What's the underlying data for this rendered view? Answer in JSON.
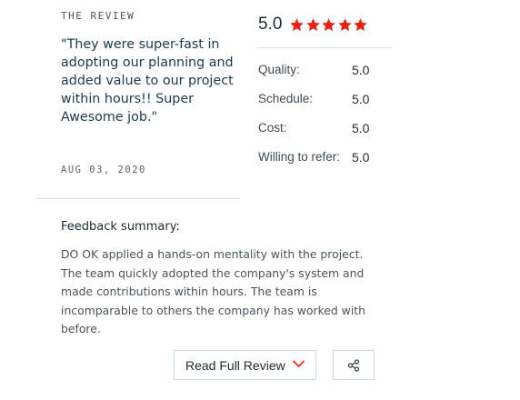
{
  "review": {
    "section_label": "THE REVIEW",
    "quote": "\"They were super-fast in adopting our planning and added value to our project within hours!! Super Awesome job.\"",
    "date": "AUG 03, 2020"
  },
  "rating": {
    "overall": "5.0",
    "stars": 5,
    "star_color": "#e62415",
    "items": [
      {
        "label": "Quality:",
        "value": "5.0"
      },
      {
        "label": "Schedule:",
        "value": "5.0"
      },
      {
        "label": "Cost:",
        "value": "5.0"
      },
      {
        "label": "Willing to refer:",
        "value": "5.0"
      }
    ]
  },
  "summary": {
    "title": "Feedback summary:",
    "text": "DO OK applied a hands-on mentality with the project. The team quickly adopted the company's system and made contributions within hours. The team is incomparable to others the company has worked with before."
  },
  "actions": {
    "read_full_label": "Read Full Review",
    "read_full_icon": "chevron-down-icon",
    "share_icon": "share-icon",
    "accent_color": "#e62415",
    "border_color": "#c6dfe3"
  }
}
